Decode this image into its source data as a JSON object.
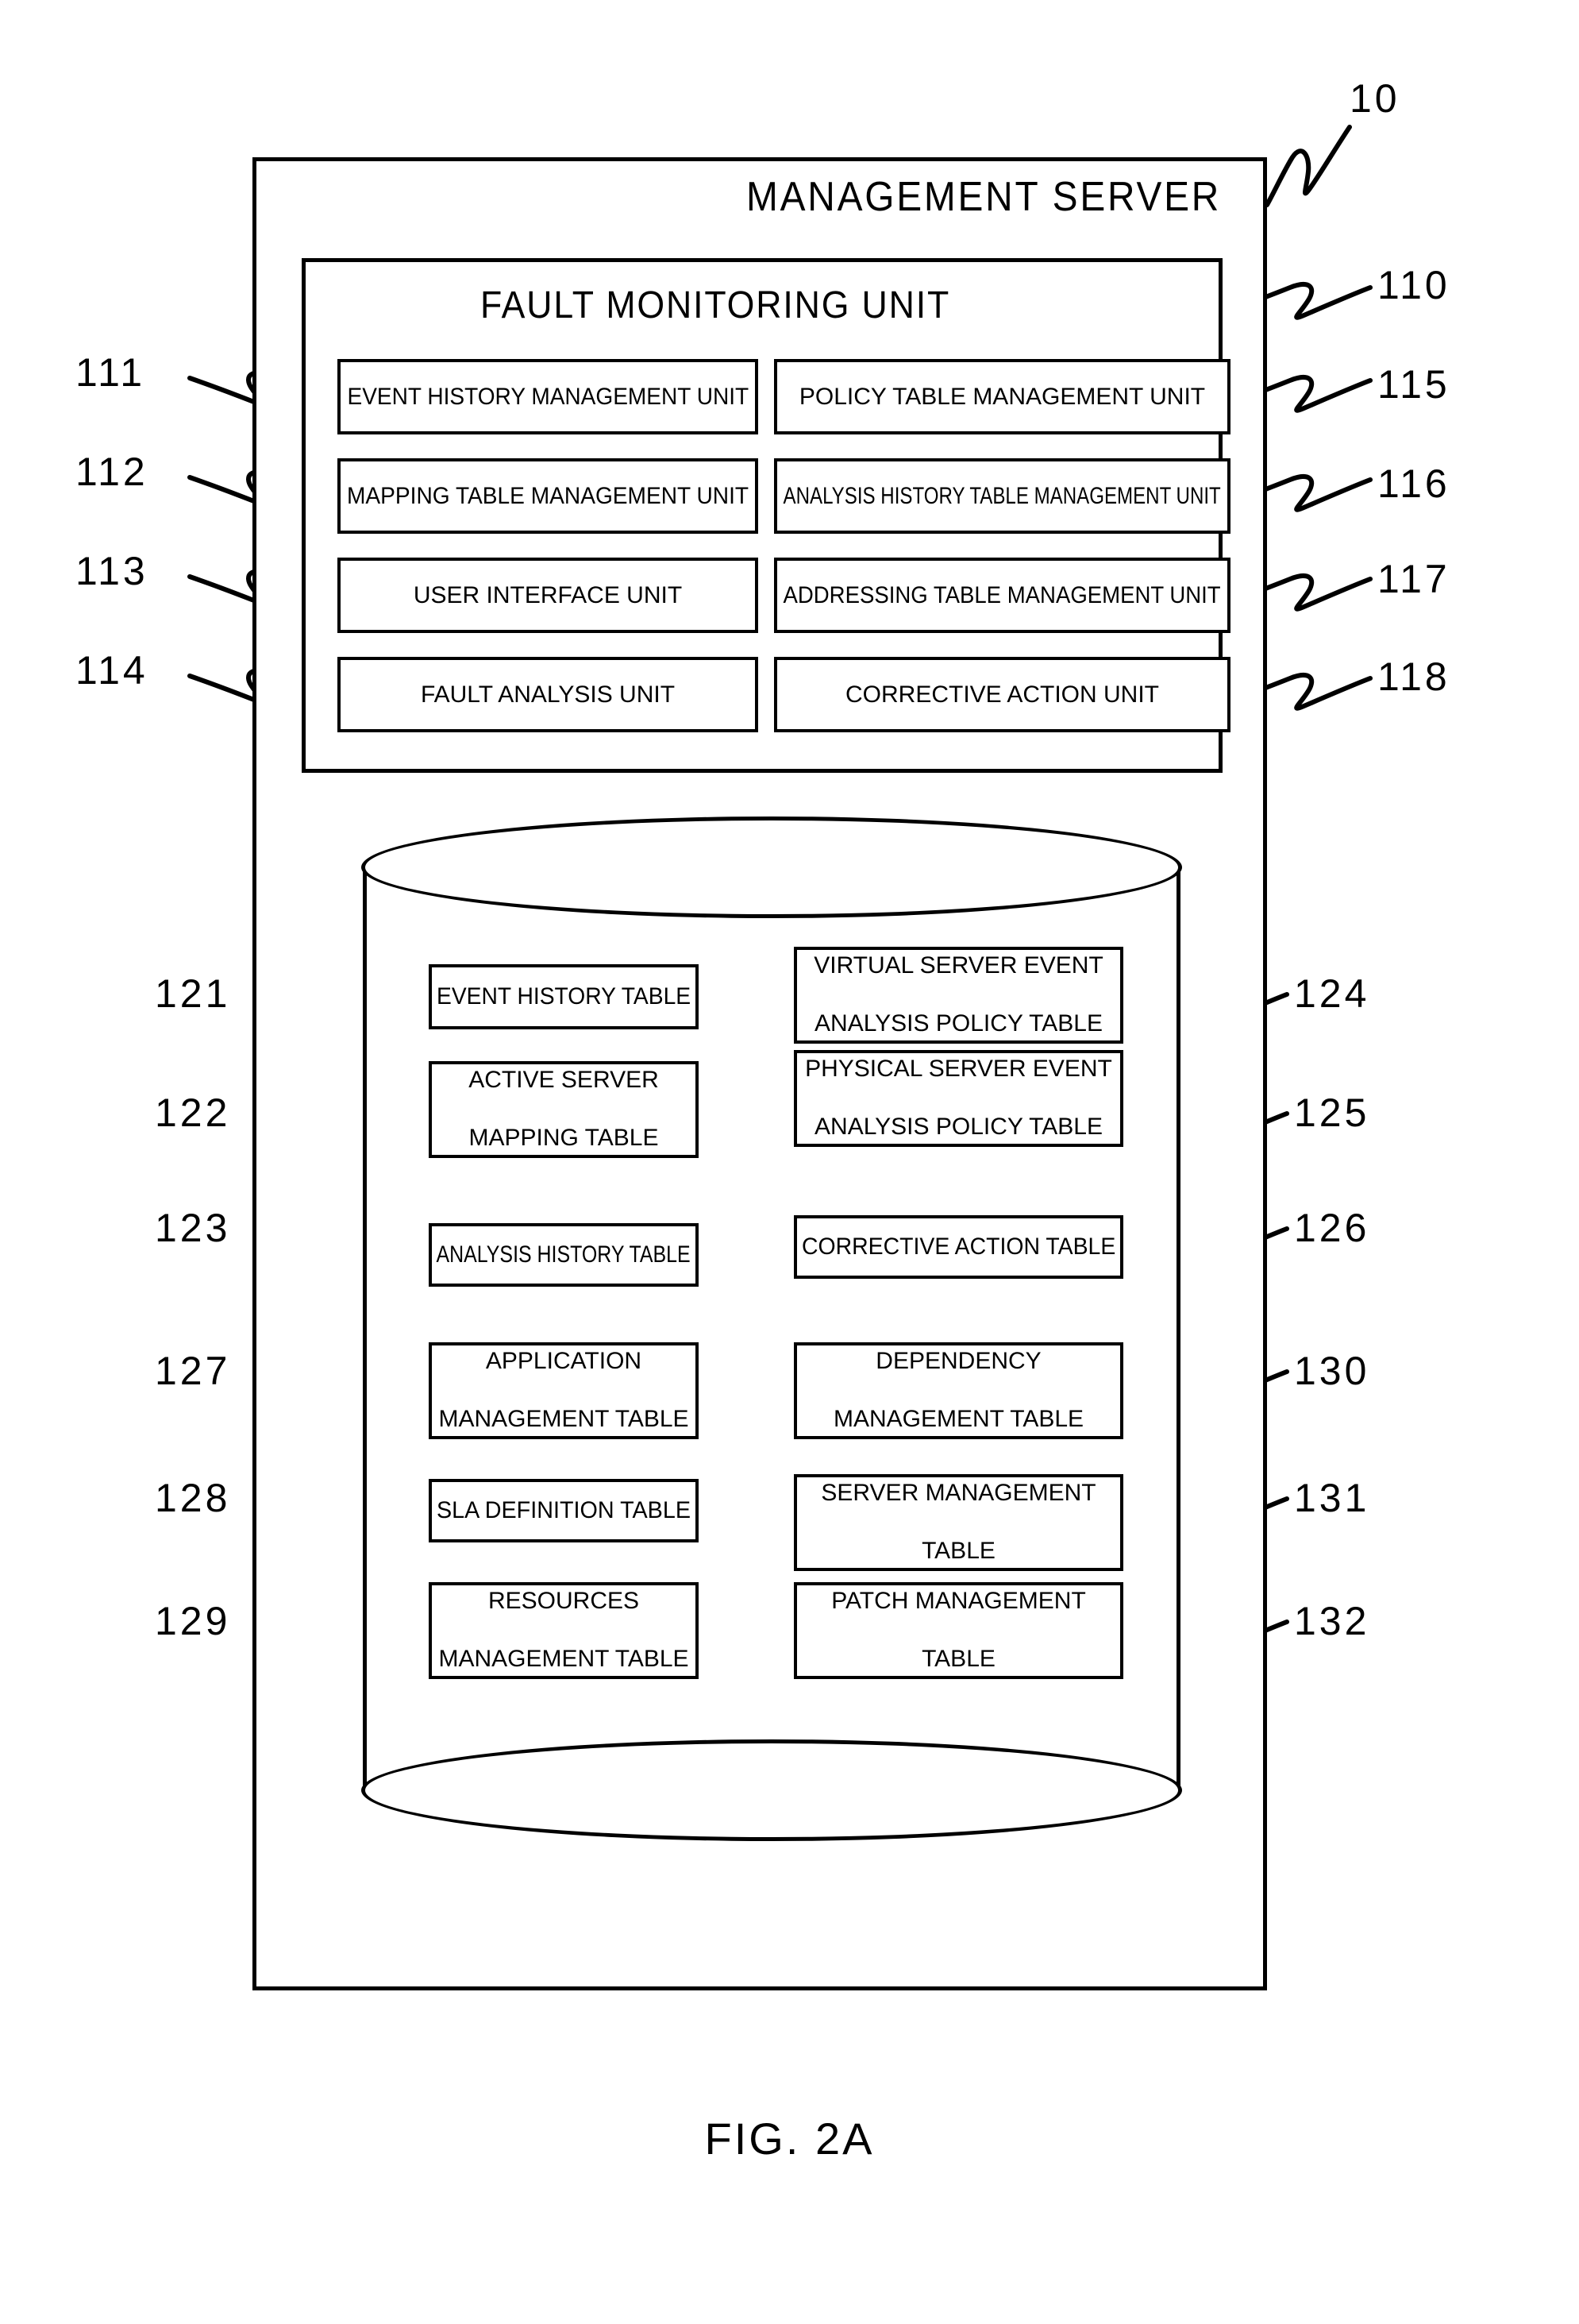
{
  "figure": {
    "caption": "FIG. 2A",
    "server_title": "MANAGEMENT SERVER",
    "server_ref": "10",
    "fmu_title": "FAULT MONITORING UNIT",
    "fmu_ref": "110"
  },
  "fault_monitoring_units": [
    {
      "ref": "111",
      "label": "EVENT HISTORY MANAGEMENT UNIT",
      "col": "left",
      "row": 1
    },
    {
      "ref": "112",
      "label": "MAPPING TABLE MANAGEMENT UNIT",
      "col": "left",
      "row": 2
    },
    {
      "ref": "113",
      "label": "USER INTERFACE UNIT",
      "col": "left",
      "row": 3
    },
    {
      "ref": "114",
      "label": "FAULT ANALYSIS UNIT",
      "col": "left",
      "row": 4
    },
    {
      "ref": "115",
      "label": "POLICY TABLE MANAGEMENT UNIT",
      "col": "right",
      "row": 1
    },
    {
      "ref": "116",
      "label": "ANALYSIS HISTORY TABLE MANAGEMENT UNIT",
      "col": "right",
      "row": 2
    },
    {
      "ref": "117",
      "label": "ADDRESSING TABLE MANAGEMENT UNIT",
      "col": "right",
      "row": 3
    },
    {
      "ref": "118",
      "label": "CORRECTIVE ACTION UNIT",
      "col": "right",
      "row": 4
    }
  ],
  "database_tables": [
    {
      "ref": "121",
      "line1": "EVENT HISTORY TABLE",
      "line2": "",
      "col": "left",
      "group": 1
    },
    {
      "ref": "122",
      "line1": "ACTIVE SERVER",
      "line2": "MAPPING TABLE",
      "col": "left",
      "group": 1
    },
    {
      "ref": "123",
      "line1": "ANALYSIS HISTORY TABLE",
      "line2": "",
      "col": "left",
      "group": 1
    },
    {
      "ref": "124",
      "line1": "VIRTUAL SERVER EVENT",
      "line2": "ANALYSIS POLICY TABLE",
      "col": "right",
      "group": 1
    },
    {
      "ref": "125",
      "line1": "PHYSICAL SERVER EVENT",
      "line2": "ANALYSIS POLICY TABLE",
      "col": "right",
      "group": 1
    },
    {
      "ref": "126",
      "line1": "CORRECTIVE ACTION TABLE",
      "line2": "",
      "col": "right",
      "group": 1
    },
    {
      "ref": "127",
      "line1": "APPLICATION",
      "line2": "MANAGEMENT TABLE",
      "col": "left",
      "group": 2
    },
    {
      "ref": "128",
      "line1": "SLA DEFINITION TABLE",
      "line2": "",
      "col": "left",
      "group": 2
    },
    {
      "ref": "129",
      "line1": "RESOURCES",
      "line2": "MANAGEMENT TABLE",
      "col": "left",
      "group": 2
    },
    {
      "ref": "130",
      "line1": "DEPENDENCY",
      "line2": "MANAGEMENT TABLE",
      "col": "right",
      "group": 2
    },
    {
      "ref": "131",
      "line1": "SERVER MANAGEMENT",
      "line2": "TABLE",
      "col": "right",
      "group": 2
    },
    {
      "ref": "132",
      "line1": "PATCH MANAGEMENT",
      "line2": "TABLE",
      "col": "right",
      "group": 2
    }
  ],
  "colors": {
    "ink": "#000000",
    "paper": "#ffffff"
  }
}
